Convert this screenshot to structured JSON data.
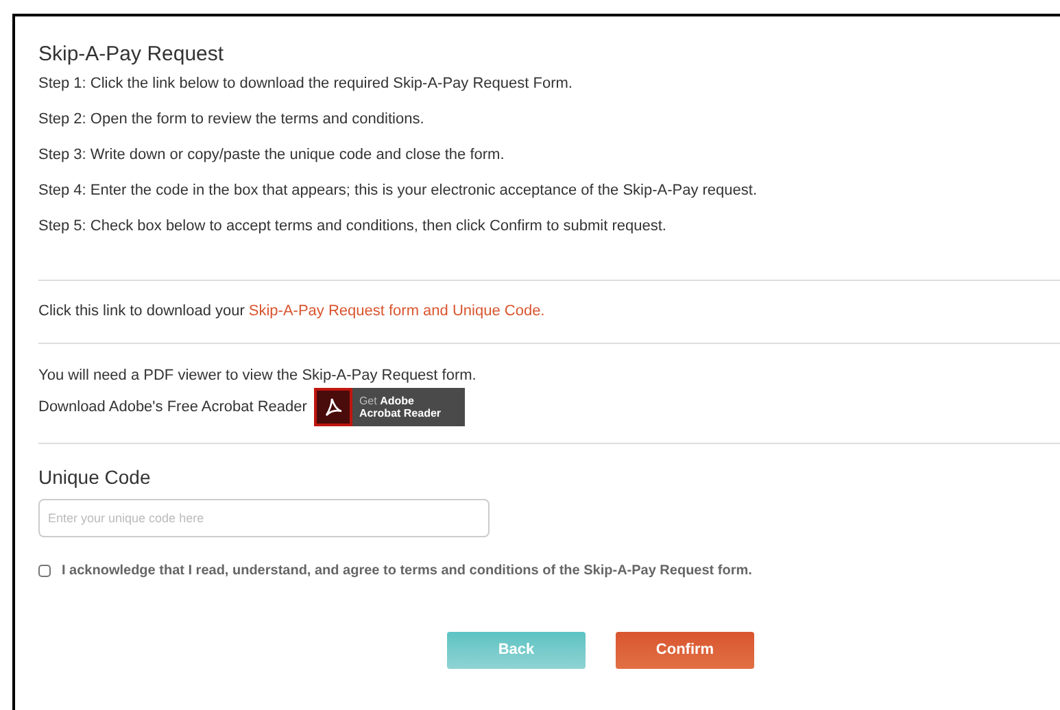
{
  "title": "Skip-A-Pay Request",
  "steps": [
    "Step 1: Click the link below to download the required Skip-A-Pay Request Form.",
    "Step 2: Open the form to review the terms and conditions.",
    "Step 3: Write down or copy/paste the unique code and close the form.",
    "Step 4: Enter the code in the box that appears; this is your electronic acceptance of the Skip-A-Pay request.",
    "Step 5: Check box below to accept terms and conditions, then click Confirm to submit request."
  ],
  "download": {
    "text": "Click this link to download your",
    "link": "Skip-A-Pay Request form and Unique Code."
  },
  "pdf_note": "You will need a PDF viewer to view the Skip-A-Pay Request form.",
  "reader": {
    "text": "Download Adobe's Free Acrobat Reader",
    "badge_small": "Get",
    "badge_brand": "Adobe",
    "badge_product": "Acrobat Reader"
  },
  "code": {
    "label": "Unique Code",
    "placeholder": "Enter your unique code here"
  },
  "acknowledge": {
    "label": "I acknowledge that I read, understand, and agree to terms and conditions of the Skip-A-Pay Request form.",
    "checked": false
  },
  "buttons": [
    {
      "label": "Back",
      "kind": "back"
    },
    {
      "label": "Confirm",
      "kind": "confirm"
    }
  ]
}
